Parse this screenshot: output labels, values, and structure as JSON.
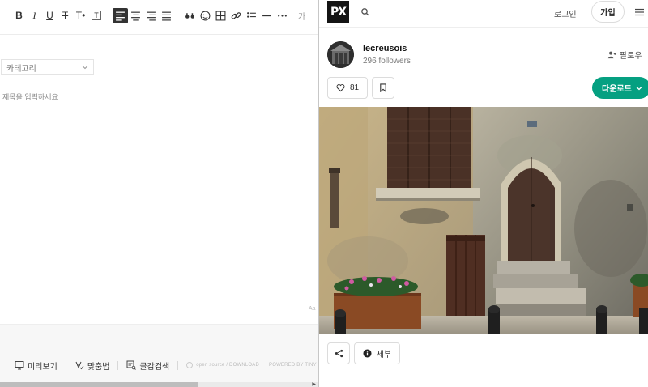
{
  "editor": {
    "toolbar": {
      "items": [
        {
          "name": "bold",
          "glyph": "B"
        },
        {
          "name": "italic",
          "glyph": "I"
        },
        {
          "name": "underline",
          "glyph": "U"
        },
        {
          "name": "strikethrough",
          "glyph": "T"
        },
        {
          "name": "text-color",
          "glyph": "T•"
        },
        {
          "name": "background-color",
          "glyph": "T"
        }
      ],
      "more_label": "가"
    },
    "category": {
      "placeholder": "카테고리"
    },
    "title": {
      "placeholder": "제목을 입력하세요",
      "value": ""
    },
    "side_mark": "Aa",
    "footer": {
      "preview_label": "미리보기",
      "spellcheck_label": "맞춤법",
      "image_search_label": "글감검색",
      "credit_1": "open source / DOWNLOAD",
      "credit_2": "POWERED BY TINY"
    }
  },
  "site": {
    "logo": "PX",
    "nav": {
      "login_label": "로그인",
      "join_label": "가입"
    },
    "author": {
      "name": "lecreusois",
      "followers": "296 followers",
      "follow_label": "팔로우"
    },
    "actions": {
      "like_count": "81",
      "download_label": "다운로드",
      "detail_label": "세부"
    },
    "colors": {
      "accent": "#05a081",
      "logo_bg": "#141414"
    }
  }
}
